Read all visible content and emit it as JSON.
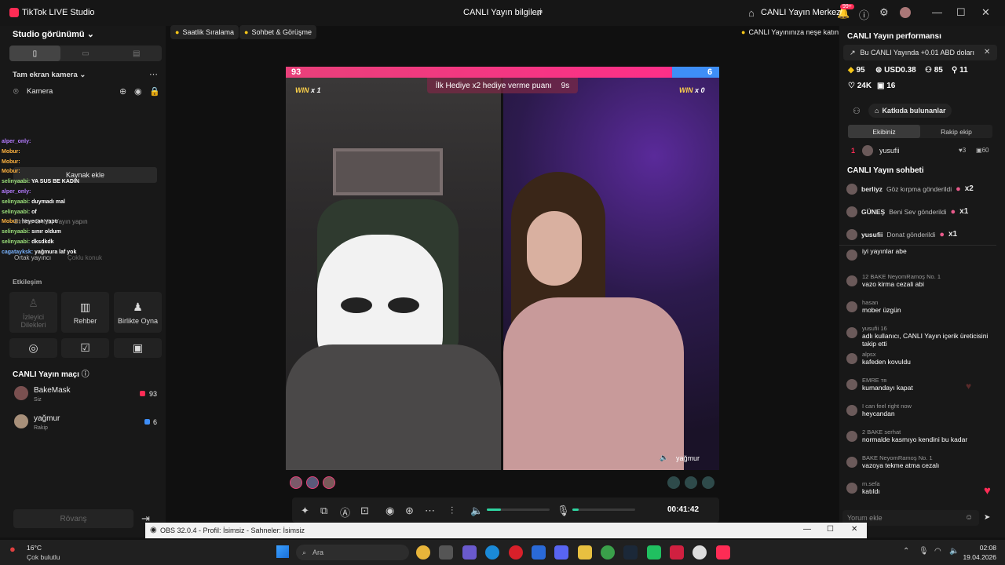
{
  "app": {
    "title": "TikTok LIVE Studio",
    "center_title": "CANLI Yayın bilgileri",
    "center_link": "CANLI Yayın Merkezi",
    "notif_badge": "99+"
  },
  "left": {
    "studio_view": "Studio görünümü",
    "camera_section": "Tam ekran kamera",
    "camera_label": "Kamera",
    "add_source": "Kaynak ekle",
    "chat_overlay": [
      {
        "name": "alper_only:",
        "text": ""
      },
      {
        "name": "Mobur:",
        "text": ""
      },
      {
        "name": "Mobur:",
        "text": ""
      },
      {
        "name": "Mobur:",
        "text": ""
      },
      {
        "name": "selinyaabi:",
        "text": "YA SUS BE KADIN"
      },
      {
        "name": "alper_only:",
        "text": ""
      },
      {
        "name": "selinyaabi:",
        "text": "duymadı mal"
      },
      {
        "name": "selinyaabi:",
        "text": "of"
      },
      {
        "name": "Mobur:",
        "text": "heyecan yaptı"
      },
      {
        "name": "selinyaabi:",
        "text": "sınır oldum"
      },
      {
        "name": "selinyaabi:",
        "text": "dksdkdk"
      },
      {
        "name": "cagatayksk:",
        "text": "yağmura laf yok"
      }
    ],
    "collab_hint": "Birlikte CANLI Yayın yapın",
    "cohost": "Ortak yayıncı",
    "multi": "Çoklu konuk",
    "interaction": "Etkileşim",
    "cards": [
      "İzleyici Dilekleri",
      "Rehber",
      "Birlikte Oyna"
    ],
    "match_title": "CANLI Yayın maçı",
    "match": [
      {
        "name": "BakeMask",
        "sub": "Siz",
        "score": "93"
      },
      {
        "name": "yağmur",
        "sub": "Rakip",
        "score": "6"
      }
    ],
    "rematch": "Rövanş"
  },
  "main": {
    "pills": [
      "Saatlik Sıralama",
      "Sohbet & Görüşme"
    ],
    "right_pill": "CANLI Yayınınıza neşe katın",
    "score_left": "93",
    "score_right": "6",
    "hint": "İlk Hediye x2 hediye verme puanı",
    "hint_time": "9s",
    "win_left": "WIN",
    "win_left_count": "x 1",
    "win_right": "WIN",
    "win_right_count": "x 0",
    "right_streamer": "yağmur",
    "timer": "00:41:42"
  },
  "right": {
    "perf_title": "CANLI Yayın performansı",
    "banner": "Bu CANLI Yayında +0.01 ABD doları",
    "stats": {
      "coins": "95",
      "usd": "USD0.38",
      "viewers": "85",
      "joined": "11",
      "likes": "24K",
      "gifts": "16"
    },
    "contributors": "Katkıda bulunanlar",
    "tab_team": "Ekibiniz",
    "tab_rival": "Rakip ekip",
    "top": {
      "rank": "1",
      "name": "yusufii",
      "a": "3",
      "b": "60"
    },
    "chat_title": "CANLI Yayın sohbeti",
    "gifts": [
      {
        "name": "berliyz",
        "text": "Göz kırpma gönderildi",
        "count": "x2"
      },
      {
        "name": "GÜNEŞ",
        "text": "Beni Sev gönderildi",
        "count": "x1"
      },
      {
        "name": "yusufii",
        "text": "Donat gönderildi",
        "count": "x1"
      }
    ],
    "messages": [
      {
        "name": "",
        "text": "iyi yayınlar abe"
      },
      {
        "name": "12 BAKE NeyomRamoş No. 1",
        "text": "vazo kirma cezali abi"
      },
      {
        "name": "hasan",
        "text": "mober üzgün"
      },
      {
        "name": "yusufii 16",
        "text": "adlı kullanıcı, CANLI Yayın içerik üreticisini takip etti"
      },
      {
        "name": "alpsx",
        "text": "kafeden kovuldu"
      },
      {
        "name": "EMRE ᴛʀ",
        "text": "kumandayı kapat"
      },
      {
        "name": "I can feel right now",
        "text": "heycandan"
      },
      {
        "name": "2 BAKE serhat",
        "text": "normalde kasmıyo kendini bu kadar"
      },
      {
        "name": "BAKE NeyomRamoş No. 1",
        "text": "vazoya tekme atma cezalı"
      },
      {
        "name": "m.sefa",
        "text": "katıldı"
      }
    ],
    "comment_placeholder": "Yorum ekle"
  },
  "obs": {
    "title": "OBS 32.0.4 - Profil: İsimsiz - Sahneler: İsimsiz"
  },
  "taskbar": {
    "temp": "16°C",
    "weather": "Çok bulutlu",
    "search": "Ara",
    "time": "02:08",
    "date": "19.04.2026"
  }
}
